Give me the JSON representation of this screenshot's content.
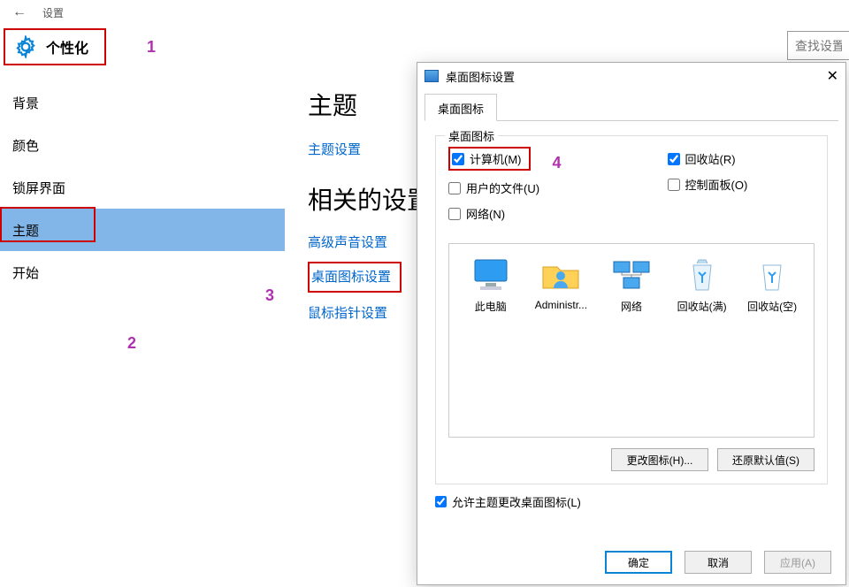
{
  "topbar": {
    "title": "设置"
  },
  "header": {
    "personalization": "个性化",
    "search_placeholder": "查找设置"
  },
  "annotations": {
    "a1": "1",
    "a2": "2",
    "a3": "3",
    "a4": "4"
  },
  "sidebar": {
    "items": [
      {
        "label": "背景",
        "selected": false
      },
      {
        "label": "颜色",
        "selected": false
      },
      {
        "label": "锁屏界面",
        "selected": false
      },
      {
        "label": "主题",
        "selected": true
      },
      {
        "label": "开始",
        "selected": false
      }
    ]
  },
  "content": {
    "theme_heading": "主题",
    "theme_settings_link": "主题设置",
    "related_heading": "相关的设置",
    "adv_sound_link": "高级声音设置",
    "desktop_icon_link": "桌面图标设置",
    "mouse_pointer_link": "鼠标指针设置"
  },
  "dialog": {
    "title": "桌面图标设置",
    "tab": "桌面图标",
    "group_title": "桌面图标",
    "checkboxes": {
      "computer": {
        "label": "计算机(M)",
        "checked": true
      },
      "user_files": {
        "label": "用户的文件(U)",
        "checked": false
      },
      "network": {
        "label": "网络(N)",
        "checked": false
      },
      "recycle": {
        "label": "回收站(R)",
        "checked": true
      },
      "control_panel": {
        "label": "控制面板(O)",
        "checked": false
      }
    },
    "icons": [
      {
        "id": "pc",
        "label": "此电脑"
      },
      {
        "id": "user",
        "label": "Administr..."
      },
      {
        "id": "net",
        "label": "网络"
      },
      {
        "id": "bin_full",
        "label": "回收站(满)"
      },
      {
        "id": "bin_empty",
        "label": "回收站(空)"
      }
    ],
    "change_icon_btn": "更改图标(H)...",
    "restore_default_btn": "还原默认值(S)",
    "allow_theme_label": "允许主题更改桌面图标(L)",
    "allow_theme_checked": true,
    "ok": "确定",
    "cancel": "取消",
    "apply": "应用(A)"
  }
}
